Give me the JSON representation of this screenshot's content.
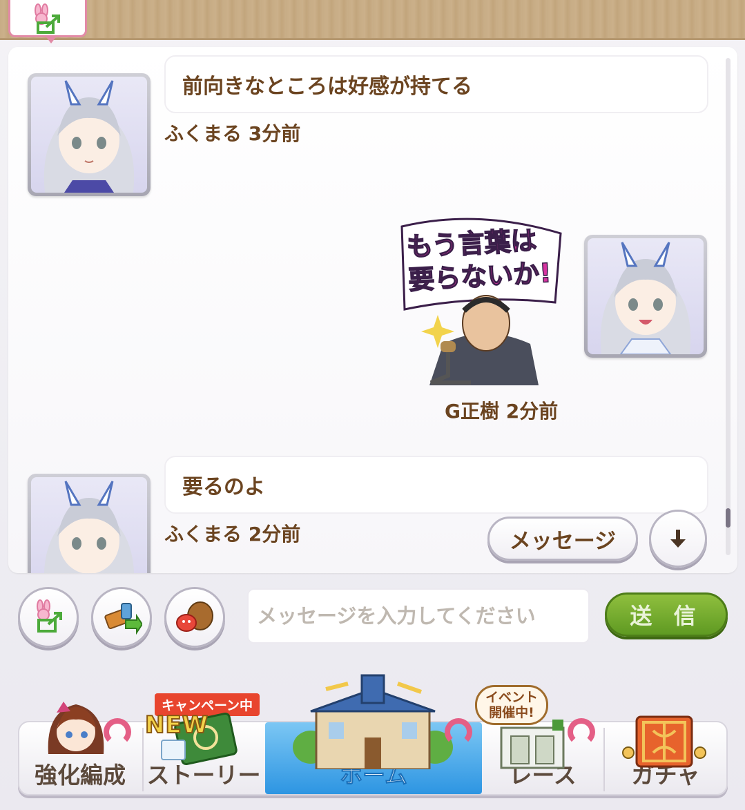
{
  "header": {
    "corner_icon": "share-bunny-icon"
  },
  "chat": {
    "messages": [
      {
        "text": "前向きなところは好感が持てる",
        "sender": "ふくまる",
        "time": "3分前"
      },
      {
        "sticker_text": "もう言葉は要らないか!",
        "sender": "G正樹",
        "time": "2分前"
      },
      {
        "text": "要るのよ",
        "sender": "ふくまる",
        "time": "2分前"
      }
    ],
    "message_button": "メッセージ",
    "scroll_down_icon": "arrow-down-icon"
  },
  "input": {
    "placeholder": "メッセージを入力してください",
    "send_label": "送 信",
    "tools": [
      "share-icon",
      "ticket-icon",
      "stamp-icon"
    ]
  },
  "nav": {
    "items": [
      {
        "label": "強化編成"
      },
      {
        "label": "ストーリー",
        "badge": "NEW",
        "campaign": "キャンペーン中"
      },
      {
        "label": "ホーム",
        "active": true
      },
      {
        "label": "レース",
        "event_line1": "イベント",
        "event_line2": "開催中!"
      },
      {
        "label": "ガチャ"
      }
    ]
  },
  "colors": {
    "text_brown": "#6b4420",
    "send_green": "#6aa52a",
    "home_blue": "#2d95e2",
    "badge_pink": "#e45f86"
  }
}
